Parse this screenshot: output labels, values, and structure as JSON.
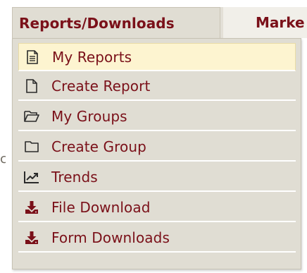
{
  "nav": {
    "active_tab_label": "Reports/Downloads",
    "next_tab_label": "Marke"
  },
  "stray_text": "c",
  "menu": {
    "items": [
      {
        "label": "My Reports",
        "icon": "document-lines-icon",
        "selected": true
      },
      {
        "label": "Create Report",
        "icon": "blank-document-icon",
        "selected": false
      },
      {
        "label": "My Groups",
        "icon": "open-folder-icon",
        "selected": false
      },
      {
        "label": "Create Group",
        "icon": "folder-icon",
        "selected": false
      },
      {
        "label": "Trends",
        "icon": "trend-chart-icon",
        "selected": false
      },
      {
        "label": "File Download",
        "icon": "download-icon",
        "selected": false
      },
      {
        "label": "Form Downloads",
        "icon": "download-icon",
        "selected": false
      }
    ]
  },
  "colors": {
    "accent_text": "#7a1019",
    "menu_bg": "#e0ddd3",
    "selected_bg": "#fdf4d0",
    "separator": "#ffffff"
  }
}
